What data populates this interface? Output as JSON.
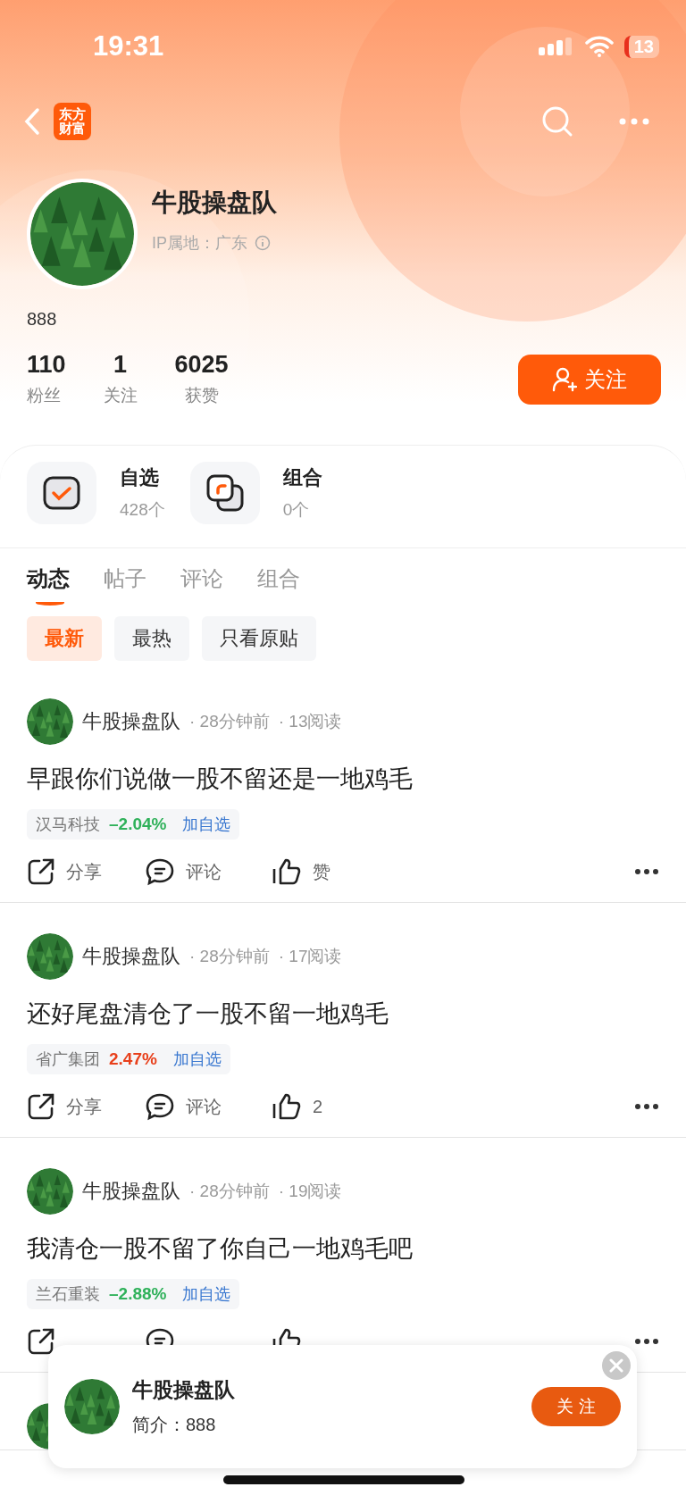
{
  "status_bar": {
    "time": "19:31",
    "battery": "13"
  },
  "nav": {
    "logo_lines": [
      "东方",
      "财富"
    ]
  },
  "profile": {
    "name": "牛股操盘队",
    "ip": "IP属地：广东",
    "bio": "888",
    "follow_button": "关注",
    "stats": [
      {
        "value": "110",
        "label": "粉丝"
      },
      {
        "value": "1",
        "label": "关注"
      },
      {
        "value": "6025",
        "label": "获赞"
      }
    ]
  },
  "shortcuts": [
    {
      "kind": "watchlist",
      "title": "自选",
      "count": "428个"
    },
    {
      "kind": "portfolio",
      "title": "组合",
      "count": "0个"
    }
  ],
  "tabs": [
    {
      "label": "动态",
      "selected": true
    },
    {
      "label": "帖子",
      "selected": false
    },
    {
      "label": "评论",
      "selected": false
    },
    {
      "label": "组合",
      "selected": false
    }
  ],
  "filters": [
    {
      "label": "最新",
      "selected": true
    },
    {
      "label": "最热",
      "selected": false
    },
    {
      "label": "只看原贴",
      "selected": false
    }
  ],
  "posts": [
    {
      "kind": "full",
      "author": "牛股操盘队",
      "time": "· 28分钟前",
      "reads": "· 13阅读",
      "title": "早跟你们说做一股不留还是一地鸡毛",
      "stock": {
        "name": "汉马科技",
        "change": "–2.04%",
        "color": "#2fb15a",
        "action": "加自选"
      },
      "actions": {
        "share": "分享",
        "comment": "评论",
        "like": "赞"
      }
    },
    {
      "kind": "full",
      "author": "牛股操盘队",
      "time": "· 28分钟前",
      "reads": "· 17阅读",
      "title": "还好尾盘清仓了一股不留一地鸡毛",
      "stock": {
        "name": "省广集团",
        "change": "2.47%",
        "color": "#e8401c",
        "action": "加自选"
      },
      "actions": {
        "share": "分享",
        "comment": "评论",
        "like": "2"
      }
    },
    {
      "kind": "full",
      "author": "牛股操盘队",
      "time": "· 28分钟前",
      "reads": "· 19阅读",
      "title": "我清仓一股不留了你自己一地鸡毛吧",
      "stock": {
        "name": "兰石重装",
        "change": "–2.88%",
        "color": "#2fb15a",
        "action": "加自选"
      }
    },
    {
      "kind": "covered"
    }
  ],
  "popup": {
    "name": "牛股操盘队",
    "bio": "简介：888",
    "follow_button": "关 注"
  }
}
